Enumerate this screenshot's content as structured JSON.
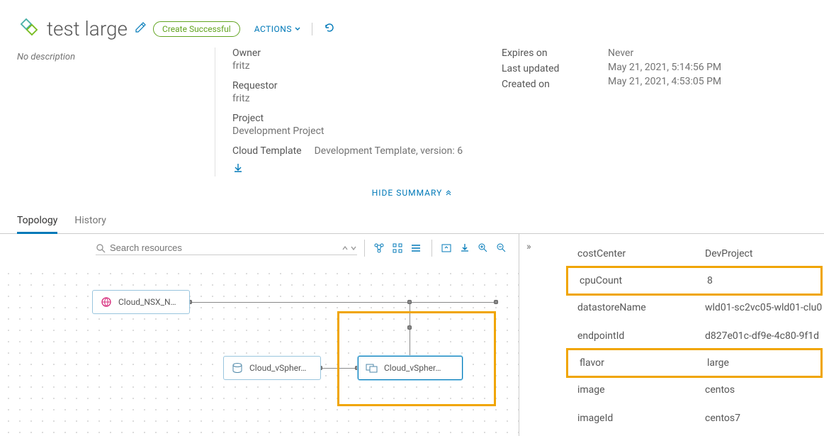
{
  "header": {
    "title": "test large",
    "status": "Create Successful",
    "actions": "ACTIONS"
  },
  "summary": {
    "description": "No description",
    "left": {
      "owner_label": "Owner",
      "owner": "fritz",
      "requestor_label": "Requestor",
      "requestor": "fritz",
      "project_label": "Project",
      "project": "Development Project",
      "template_label": "Cloud Template",
      "template": "Development Template, version: 6"
    },
    "right": {
      "expires_label": "Expires on",
      "expires": "Never",
      "updated_label": "Last updated",
      "updated": "May 21, 2021, 5:14:56 PM",
      "created_label": "Created on",
      "created": "May 21, 2021, 4:53:05 PM"
    },
    "hide": "HIDE SUMMARY"
  },
  "tabs": {
    "topology": "Topology",
    "history": "History"
  },
  "search": {
    "placeholder": "Search resources"
  },
  "nodes": {
    "nsx": "Cloud_NSX_N…",
    "vs1": "Cloud_vSpher…",
    "vs2": "Cloud_vSpher…"
  },
  "panel": {
    "costCenter_k": "costCenter",
    "costCenter_v": "DevProject",
    "cpuCount_k": "cpuCount",
    "cpuCount_v": "8",
    "datastore_k": "datastoreName",
    "datastore_v": "wld01-sc2vc05-wld01-clu0",
    "endpoint_k": "endpointId",
    "endpoint_v": "d827e01c-df9e-4c80-9f1d",
    "flavor_k": "flavor",
    "flavor_v": "large",
    "image_k": "image",
    "image_v": "centos",
    "imageId_k": "imageId",
    "imageId_v": "centos7"
  }
}
